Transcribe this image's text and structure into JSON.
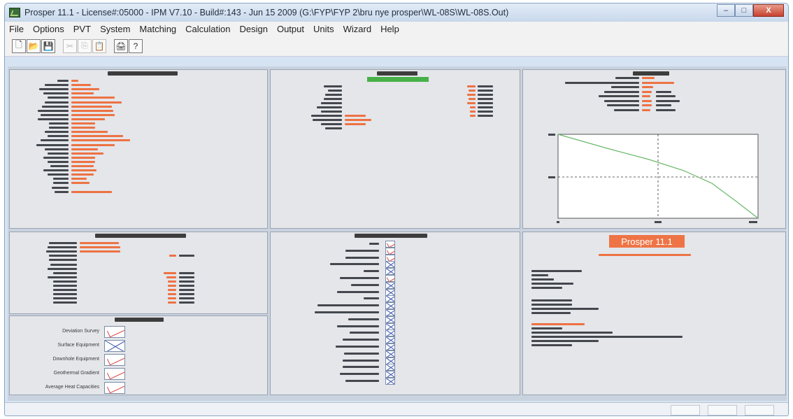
{
  "window": {
    "title": "Prosper 11.1 - License#:05000 - IPM V7.10 - Build#:143 - Jun 15 2009 (G:\\FYP\\FYP 2\\bru nye prosper\\WL-08S\\WL-08S.Out)",
    "min_label": "–",
    "max_label": "□",
    "close_label": "X"
  },
  "menu": [
    "File",
    "Options",
    "PVT",
    "System",
    "Matching",
    "Calculation",
    "Design",
    "Output",
    "Units",
    "Wizard",
    "Help"
  ],
  "toolbar": {
    "icons": [
      "new-file-icon",
      "open-folder-icon",
      "save-icon",
      "cut-icon",
      "copy-icon",
      "paste-icon",
      "print-icon",
      "help-icon"
    ],
    "glyphs": [
      "🗋",
      "📂",
      "💾",
      "✂",
      "⎘",
      "📋",
      "🖨",
      "?"
    ]
  },
  "checks": {
    "items": [
      {
        "state": "checked"
      },
      {
        "state": "checked"
      },
      {
        "state": "checked"
      },
      {
        "state": "crossed"
      },
      {
        "state": "crossed"
      },
      {
        "state": "checked"
      },
      {
        "state": "crossed"
      },
      {
        "state": "crossed"
      },
      {
        "state": "crossed"
      },
      {
        "state": "crossed"
      },
      {
        "state": "crossed"
      },
      {
        "state": "crossed"
      },
      {
        "state": "crossed"
      },
      {
        "state": "crossed"
      },
      {
        "state": "crossed"
      },
      {
        "state": "crossed"
      },
      {
        "state": "crossed"
      },
      {
        "state": "crossed"
      },
      {
        "state": "crossed"
      },
      {
        "state": "crossed"
      },
      {
        "state": "crossed"
      }
    ]
  },
  "equipment": {
    "items": [
      {
        "label": "Deviation Survey",
        "state": "checked"
      },
      {
        "label": "Surface Equipment",
        "state": "crossed"
      },
      {
        "label": "Downhole Equipment",
        "state": "checked"
      },
      {
        "label": "Geothermal Gradient",
        "state": "checked"
      },
      {
        "label": "Average Heat Capacities",
        "state": "checked"
      }
    ]
  },
  "prosper": {
    "title": "Prosper 11.1"
  },
  "colors": {
    "accent": "#ee7446",
    "header": "#3d3d3d",
    "curve": "#6ab86a",
    "pvt_bar": "#48b048"
  }
}
